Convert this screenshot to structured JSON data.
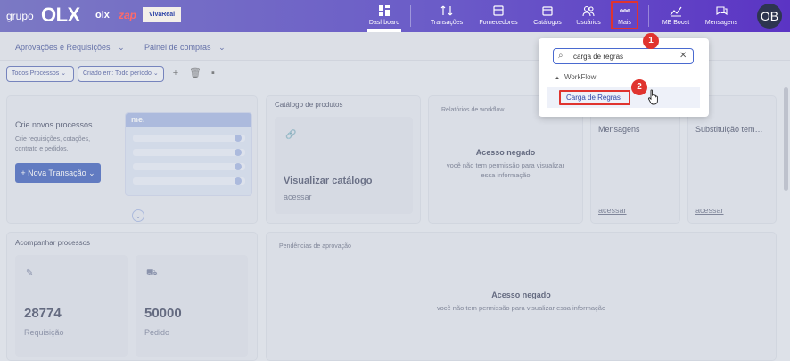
{
  "brand": {
    "grupo": "grupo",
    "olx": "OLX",
    "olx_small": "olx",
    "zap": "zap",
    "vivareal": "VivaReal"
  },
  "nav": {
    "items": [
      {
        "label": "Dashboard",
        "icon": "dashboard-icon"
      },
      {
        "label": "Transações",
        "icon": "transactions-icon"
      },
      {
        "label": "Fornecedores",
        "icon": "suppliers-icon"
      },
      {
        "label": "Catálogos",
        "icon": "catalog-icon"
      },
      {
        "label": "Usuários",
        "icon": "users-icon"
      },
      {
        "label": "Mais",
        "icon": "more-icon"
      },
      {
        "label": "ME Boost",
        "icon": "chart-icon"
      },
      {
        "label": "Mensagens",
        "icon": "messages-icon"
      }
    ],
    "avatar": "OB"
  },
  "subnav": {
    "tab1": "Aprovações e Requisições",
    "tab2": "Painel de compras"
  },
  "filters": {
    "processos": "Todos Processos",
    "periodo": "Criado em: Todo período"
  },
  "cards": {
    "criar": {
      "title": "Crie novos processos",
      "desc1": "Crie requisições, cotações,",
      "desc2": "contrato e pedidos.",
      "button": "Nova Transação",
      "mockup_brand": "me."
    },
    "catalogo": {
      "title": "Catálogo de produtos",
      "heading": "Visualizar catálogo",
      "link": "acessar"
    },
    "relatorios": {
      "title": "Relatórios de workflow",
      "denied": "Acesso negado",
      "msg1": "você não tem permissão para visualizar",
      "msg2": "essa informação"
    },
    "mensagens": {
      "title": "Mensagens",
      "link": "acessar"
    },
    "substituicao": {
      "title": "Substituição tem…",
      "link": "acessar"
    },
    "acompanhar": {
      "title": "Acompanhar processos",
      "requisicao_value": "28774",
      "requisicao_label": "Requisição",
      "pedido_value": "50000",
      "pedido_label": "Pedido"
    },
    "pendencias": {
      "title": "Pendências de aprovação",
      "denied": "Acesso negado",
      "msg": "você não tem permissão para visualizar essa informação"
    }
  },
  "dropdown": {
    "search_value": "carga de regras",
    "group": "WorkFlow",
    "item": "Carga de Regras"
  },
  "annotations": {
    "step1": "1",
    "step2": "2"
  },
  "colors": {
    "accent": "#2a4fb5",
    "highlight": "#e0342f",
    "topbar_start": "#7b79c4",
    "topbar_end": "#5b34c4"
  }
}
